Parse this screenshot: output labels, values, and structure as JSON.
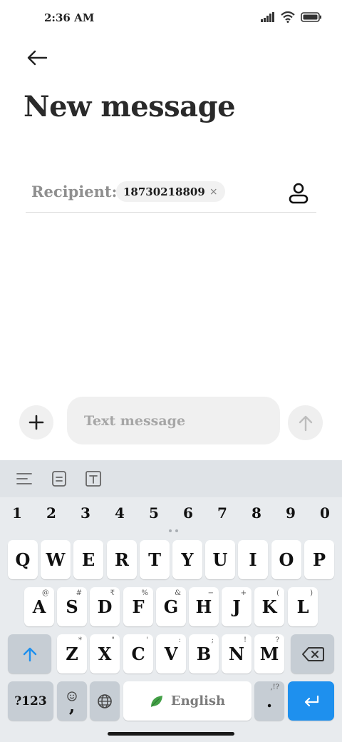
{
  "status_bar": {
    "time": "2:36 AM",
    "icons": [
      "signal-icon",
      "wifi-icon",
      "battery-icon"
    ]
  },
  "header": {
    "back_icon": "arrow-left-icon",
    "title": "New message"
  },
  "recipient": {
    "label": "Recipient:",
    "chip_value": "18730218809",
    "chip_remove": "×",
    "contact_icon": "person-icon"
  },
  "compose": {
    "attach_icon": "plus-icon",
    "placeholder": "Text message",
    "send_icon": "arrow-up-icon"
  },
  "keyboard": {
    "toolbar_icons": [
      "align-left-icon",
      "clipboard-icon",
      "text-box-icon"
    ],
    "number_row": [
      "1",
      "2",
      "3",
      "4",
      "5",
      "6",
      "7",
      "8",
      "9",
      "0"
    ],
    "row1": [
      {
        "key": "Q",
        "hint": ""
      },
      {
        "key": "W",
        "hint": ""
      },
      {
        "key": "E",
        "hint": ""
      },
      {
        "key": "R",
        "hint": ""
      },
      {
        "key": "T",
        "hint": ""
      },
      {
        "key": "Y",
        "hint": ""
      },
      {
        "key": "U",
        "hint": ""
      },
      {
        "key": "I",
        "hint": ""
      },
      {
        "key": "O",
        "hint": ""
      },
      {
        "key": "P",
        "hint": ""
      }
    ],
    "row2": [
      {
        "key": "A",
        "hint": "@"
      },
      {
        "key": "S",
        "hint": "#"
      },
      {
        "key": "D",
        "hint": "₹"
      },
      {
        "key": "F",
        "hint": "%"
      },
      {
        "key": "G",
        "hint": "&"
      },
      {
        "key": "H",
        "hint": "−"
      },
      {
        "key": "J",
        "hint": "+"
      },
      {
        "key": "K",
        "hint": "("
      },
      {
        "key": "L",
        "hint": ")"
      }
    ],
    "row3": [
      {
        "key": "Z",
        "hint": "*"
      },
      {
        "key": "X",
        "hint": "\""
      },
      {
        "key": "C",
        "hint": "'"
      },
      {
        "key": "V",
        "hint": ":"
      },
      {
        "key": "B",
        "hint": ";"
      },
      {
        "key": "N",
        "hint": "!"
      },
      {
        "key": "M",
        "hint": "?"
      }
    ],
    "symbols_label": "?123",
    "comma_label": ",",
    "period_label": ".",
    "period_hint": ",!?",
    "space_label": "English",
    "colors": {
      "enter": "#1e90ee",
      "shift_arrow": "#1e90ee",
      "leaf": "#43a047"
    }
  }
}
